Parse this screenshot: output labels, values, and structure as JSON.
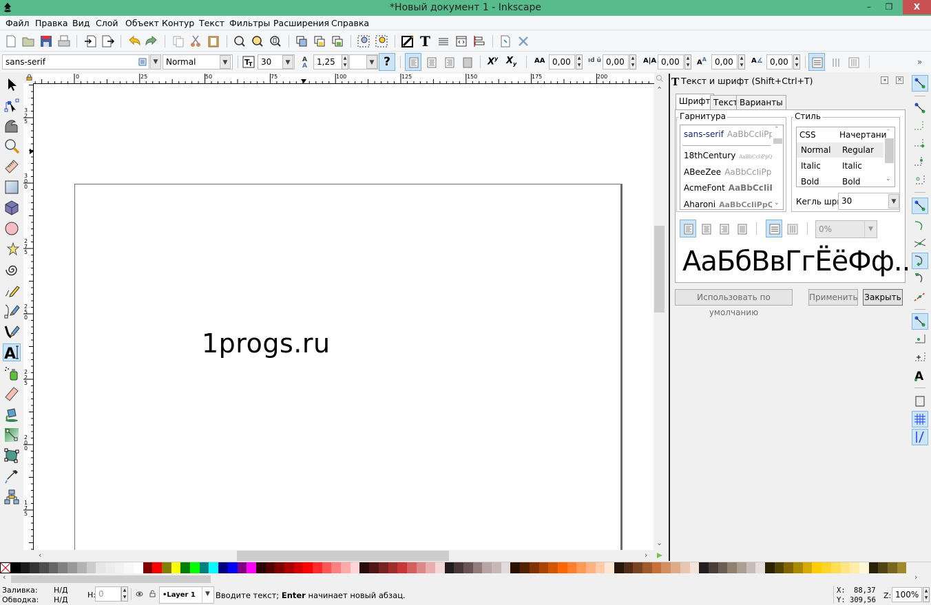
{
  "window": {
    "title": "*Новый документ 1 - Inkscape",
    "minimize": "–",
    "maximize": "❐",
    "close": "X"
  },
  "menu": [
    "Файл",
    "Правка",
    "Вид",
    "Слой",
    "Объект",
    "Контур",
    "Текст",
    "Фильтры",
    "Расширения",
    "Справка"
  ],
  "commands_toolbar": [
    "new-document",
    "open",
    "save",
    "print",
    "import",
    "export",
    "undo",
    "redo",
    "duplicate",
    "cut",
    "paste",
    "zoom-selection",
    "zoom-drawing",
    "zoom-page",
    "group",
    "lock-group",
    "unlock-group",
    "zoom-fit",
    "zoom-fit-selected",
    "fill-and-stroke",
    "text-and-font",
    "layers",
    "xml-editor",
    "align-and-distribute",
    "document-properties",
    "preferences"
  ],
  "text_toolbar": {
    "font_family": "sans-serif",
    "font_style": "Normal",
    "font_size": "30",
    "line_height": "1,25",
    "line_height_unit": "",
    "help_label": "?",
    "letter_spacing": "0,00",
    "word_spacing": "0,00",
    "kerning": "0,00",
    "vertical_shift": "0,00",
    "rotation": "0,00",
    "overflow_label": "»"
  },
  "ruler": {
    "top_labels": [
      "0",
      "25",
      "50",
      "75",
      "100",
      "125",
      "150",
      "175",
      "200"
    ],
    "left_labels": [
      "325",
      "300",
      "275",
      "250",
      "225",
      "200",
      "175"
    ]
  },
  "canvas": {
    "text": "1progs.ru"
  },
  "dock": {
    "title": "Текст и шрифт (Shift+Ctrl+T)",
    "tabs": [
      {
        "label": "Шрифт",
        "active": true
      },
      {
        "label": "Текст",
        "active": false
      },
      {
        "label": "Варианты",
        "active": false
      }
    ],
    "family_frame_label": "Гарнитура",
    "style_frame_label": "Стиль",
    "font_list": [
      {
        "name": "sans-serif",
        "sample": "AaBbCcIiPpQ",
        "selected": true
      },
      {
        "name": "18thCentury",
        "sample": "AaBbCcIiPpQ"
      },
      {
        "name": "ABeeZee",
        "sample": "AaBbCcIiPpQ"
      },
      {
        "name": "AcmeFont",
        "sample": "AaBbCcIiPp"
      },
      {
        "name": "Aharoni",
        "sample": "AaBbCcIiPpQ"
      }
    ],
    "style_columns": [
      "CSS",
      "Начертани"
    ],
    "style_rows": [
      {
        "css": "Normal",
        "face": "Regular",
        "selected": true
      },
      {
        "css": "Italic",
        "face": "Italic"
      },
      {
        "css": "Bold",
        "face": "Bold"
      }
    ],
    "size_label": "Кегль шри",
    "size_value": "30",
    "spacing_value": "0%",
    "preview": "АаБбВвГгЁёФф...",
    "buttons": {
      "default": "Использовать по умолчанию",
      "apply": "Применить",
      "close": "Закрыть"
    }
  },
  "palette": [
    "#000000",
    "#1a1a1a",
    "#333333",
    "#4d4d4d",
    "#666666",
    "#808080",
    "#999999",
    "#b3b3b3",
    "#cccccc",
    "#e6e6e6",
    "#ececec",
    "#f2f2f2",
    "#f8f8f8",
    "#ffffff",
    "#800000",
    "#ff0000",
    "#808000",
    "#ffff00",
    "#008000",
    "#00ff00",
    "#008080",
    "#00ffff",
    "#000080",
    "#0000ff",
    "#800080",
    "#ff00ff",
    "#2b0000",
    "#550000",
    "#800000",
    "#aa0000",
    "#d40000",
    "#ff0000",
    "#ff2a2a",
    "#ff5555",
    "#ff8080",
    "#ffaaaa",
    "#ffd5d5",
    "#280b0b",
    "#501616",
    "#782121",
    "#a02c2c",
    "#c83737",
    "#d35f5f",
    "#de8787",
    "#e9afaf",
    "#f4d7d7",
    "#241c1c",
    "#483737",
    "#6c5353",
    "#917c7c",
    "#b7a4a4",
    "#c8b7b7",
    "#e3dbdb",
    "#2b1100",
    "#552200",
    "#803300",
    "#aa4400",
    "#d45500",
    "#ff6600",
    "#ff7f2a",
    "#ff9955",
    "#ffb380",
    "#ffccaa",
    "#ffe6d5",
    "#28170b",
    "#502d16",
    "#784421",
    "#a05a2c",
    "#c87137",
    "#d38d5f",
    "#deaa87",
    "#e9c6af",
    "#f4e3d7",
    "#241f1c",
    "#483e37",
    "#6c5d53",
    "#917f6f",
    "#ab9f94",
    "#c8beb7",
    "#e3dedb",
    "#2b2200",
    "#554400",
    "#806600",
    "#aa8800",
    "#d4aa00",
    "#ffcc00",
    "#ffd42a",
    "#ffdd55",
    "#ffe680",
    "#ffeeaa",
    "#fff6d5",
    "#28220b",
    "#504416",
    "#786721",
    "#a0892c"
  ],
  "status": {
    "fill_label": "Заливка:",
    "fill_value": "Н/Д",
    "stroke_label": "Обводка:",
    "stroke_value": "Н/Д",
    "h_label": "H:",
    "h_value": "0",
    "layer": "•Layer 1",
    "message_pre": "Вводите текст; ",
    "message_bold": "Enter",
    "message_post": " начинает новый абзац.",
    "x_label": "X:",
    "x_value": "88,37",
    "y_label": "Y:",
    "y_value": "309,56",
    "zoom_label": "Z:",
    "zoom_value": "100%"
  }
}
